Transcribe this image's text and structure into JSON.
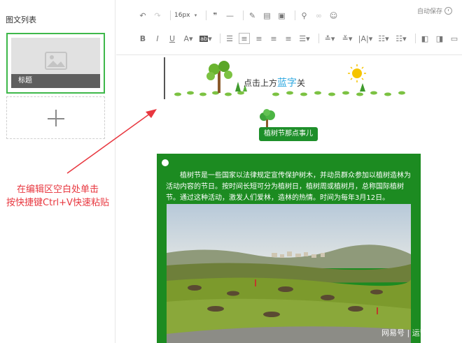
{
  "sidebar": {
    "title": "图文列表",
    "card_caption": "标题"
  },
  "hint": {
    "line1": "在编辑区空白处单击",
    "line2": "按快捷键Ctrl+V快速粘贴"
  },
  "toolbar": {
    "font_size": "16px",
    "autosave_label": "自动保存",
    "row1_icons": [
      "undo-icon",
      "redo-icon",
      "font-size-select",
      "quote-icon",
      "horizontal-rule-icon",
      "format-painter-icon",
      "paste-text-icon",
      "clear-format-icon",
      "link-icon",
      "unlink-icon",
      "emoji-icon"
    ],
    "row2_icons": [
      "bold-icon",
      "italic-icon",
      "underline-icon",
      "font-color-icon",
      "background-color-icon",
      "indent-icon",
      "align-left-icon",
      "align-center-icon",
      "align-right-icon",
      "justify-icon",
      "line-height-icon",
      "spacing-before-icon",
      "spacing-after-icon",
      "letter-spacing-icon",
      "list-icon",
      "ordered-list-icon",
      "float-left-icon",
      "float-right-icon",
      "float-none-icon"
    ]
  },
  "editor": {
    "banner_text_prefix": "点击上方",
    "banner_text_blue": "蓝字",
    "banner_text_suffix": "关",
    "pill_label": "植树节那点事儿",
    "paragraph": "植树节是一些国家以法律规定宣传保护树木，并动员群众参加以植树造林为活动内容的节日。按时间长短可分为植树日，植树周或植树月，总称国际植树节。通过这种活动，激发人们爱林，造林的热情。时间为每年3月12日。",
    "watermark": "网易号 | 运营小白"
  },
  "colors": {
    "accent_green": "#3eb84a",
    "box_green": "#1c8b21",
    "hint_red": "#e8373f",
    "banner_blue": "#2ea8e0"
  }
}
